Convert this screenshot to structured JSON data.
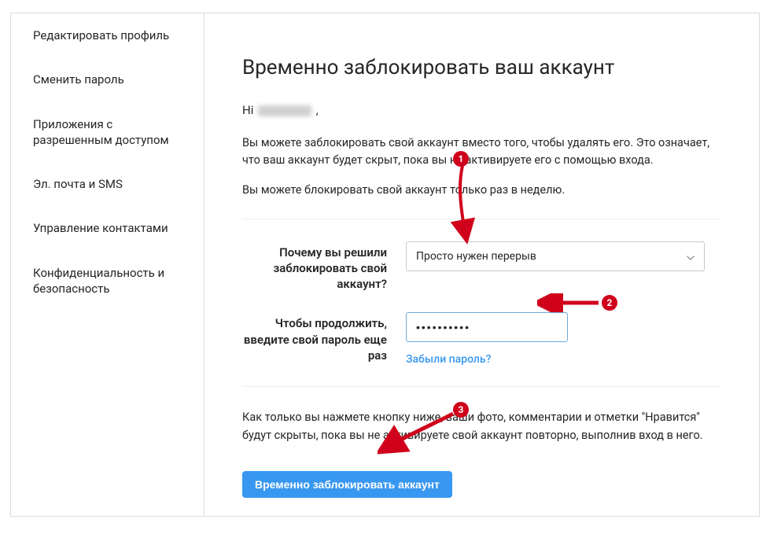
{
  "sidebar": {
    "items": [
      {
        "label": "Редактировать профиль"
      },
      {
        "label": "Сменить пароль"
      },
      {
        "label": "Приложения с разрешенным доступом"
      },
      {
        "label": "Эл. почта и SMS"
      },
      {
        "label": "Управление контактами"
      },
      {
        "label": "Конфиденциальность и безопасность"
      }
    ]
  },
  "main": {
    "title": "Временно заблокировать ваш аккаунт",
    "greeting_prefix": "Hi ",
    "greeting_suffix": " ,",
    "description": "Вы можете заблокировать свой аккаунт вместо того, чтобы удалять его. Это означает, что ваш аккаунт будет скрыт, пока вы не активируете его с помощью входа.",
    "description2": "Вы можете блокировать свой аккаунт только раз в неделю.",
    "reason_label": "Почему вы решили заблокировать свой аккаунт?",
    "reason_value": "Просто нужен перерыв",
    "password_label": "Чтобы продолжить, введите свой пароль еще раз",
    "password_value": "••••••••••",
    "forgot_password": "Забыли пароль?",
    "bottom_description": "Как только вы нажмете кнопку ниже, ваши фото, комментарии и отметки \"Нравится\" будут скрыты, пока вы не активируете свой аккаунт повторно, выполнив вход в него.",
    "disable_button": "Временно заблокировать аккаунт"
  },
  "annotations": {
    "badge1": "1",
    "badge2": "2",
    "badge3": "3"
  }
}
